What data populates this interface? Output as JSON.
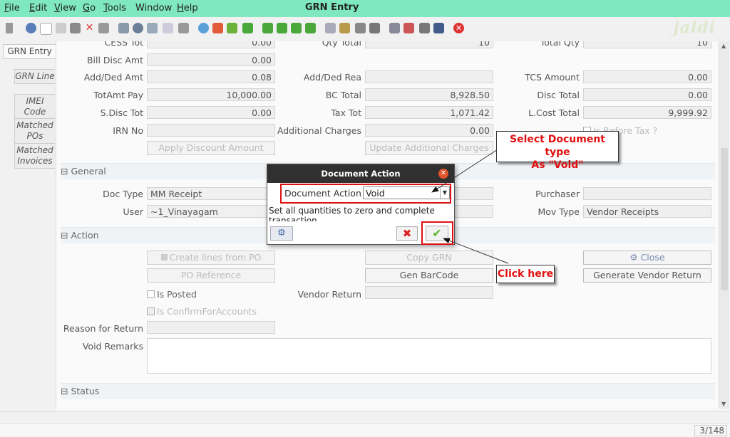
{
  "menu": {
    "items": [
      {
        "pre": "",
        "ul": "F",
        "post": "ile"
      },
      {
        "pre": "",
        "ul": "E",
        "post": "dit"
      },
      {
        "pre": "",
        "ul": "V",
        "post": "iew"
      },
      {
        "pre": "",
        "ul": "G",
        "post": "o"
      },
      {
        "pre": "",
        "ul": "T",
        "post": "ools"
      },
      {
        "pre": "Window",
        "ul": "",
        "post": ""
      },
      {
        "pre": "",
        "ul": "H",
        "post": "elp"
      }
    ],
    "title": "GRN Entry"
  },
  "logo": "jaldi",
  "tabs": [
    "GRN Entry",
    "GRN Line",
    "IMEI Code",
    "Matched POs",
    "Matched Invoices"
  ],
  "fields": {
    "cess_tot": {
      "label": "CESS Tot",
      "value": "0.00"
    },
    "qty_total": {
      "label": "Qty Total",
      "value": "10"
    },
    "total_qty": {
      "label": "Total Qty",
      "value": "10"
    },
    "bill_disc_amt": {
      "label": "Bill Disc Amt",
      "value": "0.00"
    },
    "add_ded_amt": {
      "label": "Add/Ded Amt",
      "value": "0.08"
    },
    "add_ded_rea": {
      "label": "Add/Ded Rea",
      "value": ""
    },
    "tcs_amount": {
      "label": "TCS Amount",
      "value": "0.00"
    },
    "totamt_pay": {
      "label": "TotAmt Pay",
      "value": "10,000.00"
    },
    "bc_total": {
      "label": "BC Total",
      "value": "8,928.50"
    },
    "disc_total": {
      "label": "Disc Total",
      "value": "0.00"
    },
    "s_disc_tot": {
      "label": "S.Disc Tot",
      "value": "0.00"
    },
    "tax_tot": {
      "label": "Tax Tot",
      "value": "1,071.42"
    },
    "lcost_total": {
      "label": "L.Cost Total",
      "value": "9,999.92"
    },
    "irn_no": {
      "label": "IRN No",
      "value": ""
    },
    "additional_charges": {
      "label": "Additional Charges",
      "value": "0.00"
    },
    "is_before_tax": "Is Before Tax ?"
  },
  "buttons": {
    "apply_discount": "Apply Discount Amount",
    "update_additional": "Update Additional Charges",
    "create_lines": "Create lines from PO",
    "copy_grn": "Copy GRN",
    "close": "Close",
    "po_reference": "PO Reference",
    "gen_barcode": "Gen BarCode",
    "gen_vendor_return": "Generate Vendor Return"
  },
  "general": {
    "section": "General",
    "doc_type_label": "Doc Type",
    "doc_type": "MM Receipt",
    "user_label": "User",
    "user": "~1_Vinayagam",
    "purchaser_label": "Purchaser",
    "purchaser": "",
    "mov_type_label": "Mov Type",
    "mov_type": "Vendor Receipts"
  },
  "action": {
    "section": "Action",
    "is_posted": "Is Posted",
    "vendor_return_label": "Vendor Return",
    "is_confirm": "Is ConfirmForAccounts",
    "reason_label": "Reason for Return",
    "void_remarks_label": "Void Remarks"
  },
  "status": {
    "section": "Status"
  },
  "footer": {
    "counter": "3/148"
  },
  "dialog": {
    "title": "Document Action",
    "action_label": "Document Action",
    "action_value": "Void",
    "description": "Set all quantities to zero and complete transaction"
  },
  "annotations": {
    "select_line1": "Select Document type",
    "select_line2": "As \"Void\"",
    "click_here": "Click here"
  },
  "colors": {
    "menubar": "#7fe8c0",
    "annotation_red": "#e01010",
    "dialog_title_bg": "#303030",
    "ok_green": "#5ab82a",
    "cancel_red": "#d22"
  }
}
